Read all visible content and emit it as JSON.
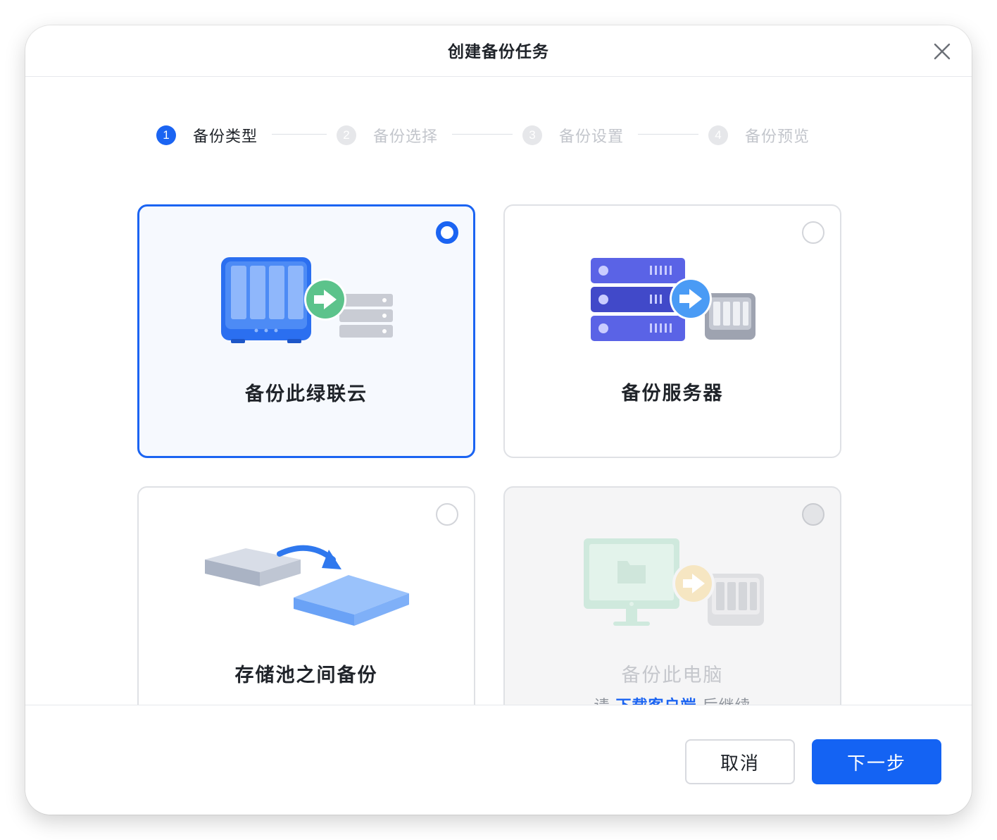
{
  "dialog": {
    "title": "创建备份任务",
    "close_icon": "close-icon"
  },
  "steps": [
    {
      "num": "1",
      "label": "备份类型",
      "active": true
    },
    {
      "num": "2",
      "label": "备份选择",
      "active": false
    },
    {
      "num": "3",
      "label": "备份设置",
      "active": false
    },
    {
      "num": "4",
      "label": "备份预览",
      "active": false
    }
  ],
  "options": [
    {
      "title": "备份此绿联云",
      "selected": true,
      "disabled": false,
      "icon": "nas-to-server-icon"
    },
    {
      "title": "备份服务器",
      "selected": false,
      "disabled": false,
      "icon": "server-to-nas-icon"
    },
    {
      "title": "存储池之间备份",
      "selected": false,
      "disabled": false,
      "icon": "pool-to-pool-icon"
    },
    {
      "title": "备份此电脑",
      "selected": false,
      "disabled": true,
      "icon": "pc-to-nas-icon",
      "hint": {
        "prefix": "请",
        "link": "下载客户端",
        "suffix": "后继续"
      }
    }
  ],
  "footer": {
    "cancel_label": "取消",
    "next_label": "下一步"
  },
  "colors": {
    "accent": "#1b64f2",
    "border": "#dfe1e5"
  }
}
